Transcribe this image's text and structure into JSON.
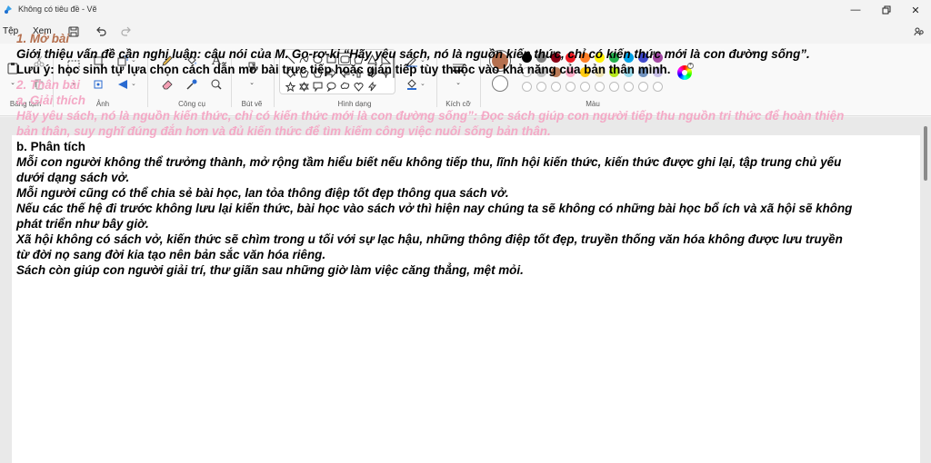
{
  "window": {
    "title": "Không có tiêu đề - Vẽ"
  },
  "menu": {
    "file": "Tệp",
    "view": "Xem"
  },
  "ribbon": {
    "clipboard_label": "Bảng tạm",
    "image_label": "Ảnh",
    "tools_label": "Công cụ",
    "brushes_label": "Bút vẽ",
    "shapes_label": "Hình dạng",
    "size_label": "Kích cỡ",
    "colors_label": "Màu"
  },
  "colors": {
    "primary": "#b5704f",
    "secondary": "#ffffff",
    "palette_row1": [
      "#000000",
      "#7f7f7f",
      "#880015",
      "#ed1c24",
      "#ff7f27",
      "#fff200",
      "#22b14c",
      "#00a2e8",
      "#3f48cc",
      "#a349a4"
    ],
    "palette_row2": [
      "#ffffff",
      "#c3c3c3",
      "#b97a57",
      "#ffaec9",
      "#ffc90e",
      "#efe4b0",
      "#b5e61d",
      "#99d9ea",
      "#7092be",
      "#c8bfe7"
    ]
  },
  "essay": {
    "l1": "1. Mở bài",
    "l2": "Giới thiệu vấn đề cần nghị luận: câu nói của M. Go-rơ-ki “Hãy yêu sách, nó là nguồn kiến thức, chỉ có kiến thức mới là con đường sống”.",
    "l3": "Lưu ý: học sinh tự lựa chọn cách dẫn mở bài trực tiếp hoặc gián tiếp tùy thuộc vào khả năng của bản thân mình.",
    "l4": "2. Thân bài",
    "l5": "a. Giải thích",
    "l6": "Hãy yêu sách, nó là nguồn kiến thức, chỉ có kiến thức mới là con đường sống”: Đọc sách giúp con người tiếp thu nguồn tri thức để hoàn thiện",
    "l7": "bản thân, suy nghĩ đúng đắn hơn và đủ kiến thức để tìm kiếm công việc nuôi sống bản thân.",
    "l8": "b. Phân tích",
    "l9": "Mỗi con người không thể trưởng thành, mở rộng tầm hiểu biết nếu không tiếp thu, lĩnh hội kiến thức, kiến thức được ghi lại, tập trung chủ yếu",
    "l10": "dưới dạng sách vở.",
    "l11": "Mỗi người cũng có thể chia sẻ bài học, lan tỏa thông điệp tốt đẹp thông qua sách vở.",
    "l12": "Nếu các thế hệ đi trước không lưu lại kiến thức, bài học vào sách vở thì hiện nay chúng ta sẽ không có những bài học bổ ích và xã hội sẽ không",
    "l13": "phát triển như bây giờ.",
    "l14": "Xã hội không có sách vở, kiến thức sẽ chìm trong u tối với sự lạc hậu, những thông điệp tốt đẹp, truyền thống văn hóa không được lưu truyền",
    "l15": "từ đời nọ sang đời kia tạo nên bản sắc văn hóa riêng.",
    "l16": "Sách còn giúp con người giải trí, thư giãn sau những giờ làm việc căng thẳng, mệt mỏi."
  }
}
